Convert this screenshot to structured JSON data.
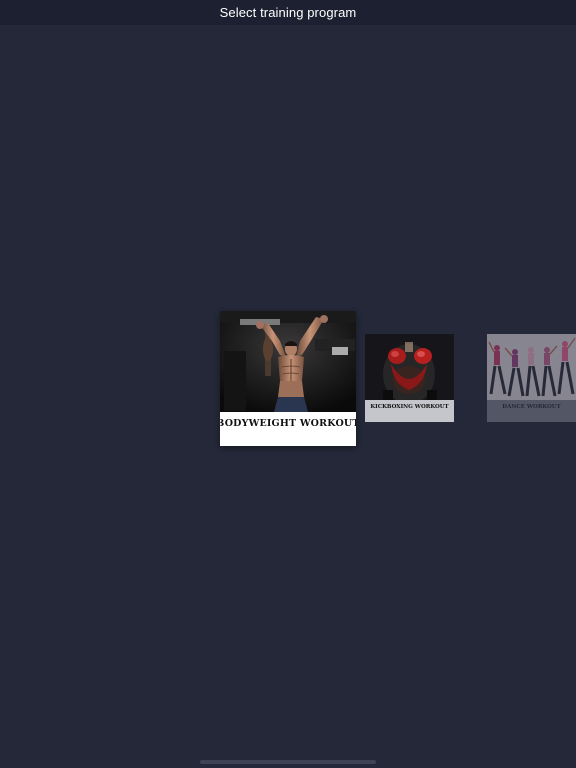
{
  "header": {
    "title": "Select training program"
  },
  "programs": [
    {
      "label": "BODYWEIGHT WORKOUT",
      "state": "selected"
    },
    {
      "label": "KICKBOXING WORKOUT",
      "state": "adjacent"
    },
    {
      "label": "DANCE WORKOUT",
      "state": "far"
    }
  ],
  "colors": {
    "background": "#242838",
    "nav_bar": "#1d2030",
    "title_text": "#ffffff",
    "card_label_bg": "#ffffff"
  }
}
